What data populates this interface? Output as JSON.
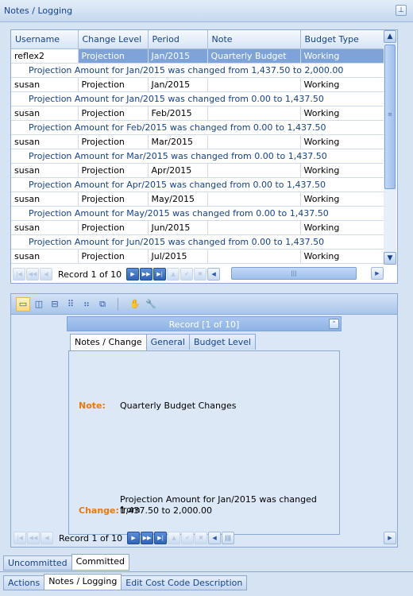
{
  "panel": {
    "title": "Notes / Logging",
    "pin_icon": "pin-icon"
  },
  "grid": {
    "columns": [
      "Username",
      "Change Level",
      "Period",
      "Note",
      "Budget Type"
    ],
    "rows": [
      {
        "username": "reflex2",
        "level": "Projection",
        "period": "Jan/2015",
        "note": "Quarterly Budget",
        "type": "Working",
        "detail": "Projection Amount for Jan/2015 was changed from 1,437.50 to 2,000.00"
      },
      {
        "username": "susan",
        "level": "Projection",
        "period": "Jan/2015",
        "note": "",
        "type": "Working",
        "detail": "Projection Amount for Jan/2015 was changed from 0.00 to 1,437.50"
      },
      {
        "username": "susan",
        "level": "Projection",
        "period": "Feb/2015",
        "note": "",
        "type": "Working",
        "detail": "Projection Amount for Feb/2015 was changed from 0.00 to 1,437.50"
      },
      {
        "username": "susan",
        "level": "Projection",
        "period": "Mar/2015",
        "note": "",
        "type": "Working",
        "detail": "Projection Amount for Mar/2015 was changed from 0.00 to 1,437.50"
      },
      {
        "username": "susan",
        "level": "Projection",
        "period": "Apr/2015",
        "note": "",
        "type": "Working",
        "detail": "Projection Amount for Apr/2015 was changed from 0.00 to 1,437.50"
      },
      {
        "username": "susan",
        "level": "Projection",
        "period": "May/2015",
        "note": "",
        "type": "Working",
        "detail": "Projection Amount for May/2015 was changed from 0.00 to 1,437.50"
      },
      {
        "username": "susan",
        "level": "Projection",
        "period": "Jun/2015",
        "note": "",
        "type": "Working",
        "detail": "Projection Amount for Jun/2015 was changed from 0.00 to 1,437.50"
      },
      {
        "username": "susan",
        "level": "Projection",
        "period": "Jul/2015",
        "note": "",
        "type": "Working",
        "detail": ""
      }
    ],
    "navigator_text": "Record 1 of 10"
  },
  "card": {
    "header": "Record [1 of 10]",
    "tabs": [
      "Notes / Change",
      "General",
      "Budget Level"
    ],
    "note_label": "Note:",
    "note_value": "Quarterly Budget Changes",
    "change_label": "Change:",
    "change_value_line1": "Projection Amount for Jan/2015 was changed from",
    "change_value_line2": "1,437.50 to 2,000.00",
    "navigator_text": "Record 1 of 10"
  },
  "bottom_tabs_upper": [
    "Uncommitted",
    "Committed"
  ],
  "bottom_tabs_lower": [
    "Actions",
    "Notes / Logging",
    "Edit Cost Code Description"
  ],
  "colors": {
    "accent": "#15428b",
    "selection": "#7ea3d8",
    "label_orange": "#e87a0d"
  }
}
